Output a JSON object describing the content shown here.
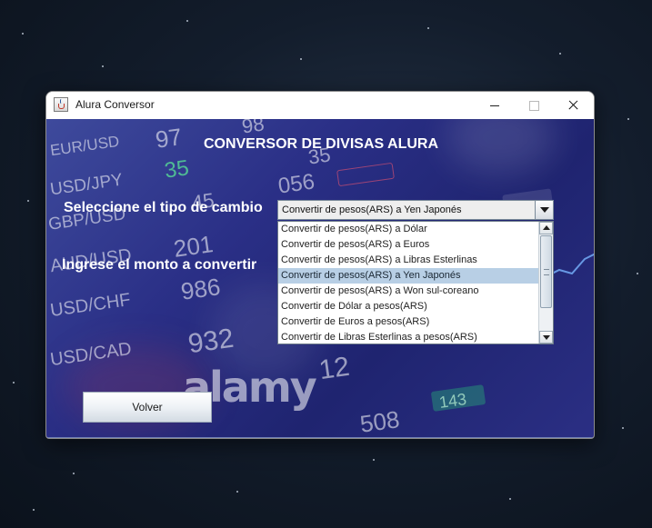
{
  "window": {
    "title": "Alura Conversor",
    "controls": {
      "minimize": "minimize",
      "maximize": "maximize",
      "close": "close"
    }
  },
  "main": {
    "heading": "CONVERSOR DE DIVISAS ALURA",
    "exchange_type_label": "Seleccione el tipo de cambio",
    "amount_label": "Ingrese el monto a convertir",
    "back_button": "Volver"
  },
  "combo": {
    "selected": "Convertir de pesos(ARS) a Yen Japonés",
    "options": [
      "Convertir de pesos(ARS) a Dólar",
      "Convertir de pesos(ARS) a Euros",
      "Convertir de pesos(ARS) a Libras Esterlinas",
      "Convertir de pesos(ARS) a Yen Japonés",
      "Convertir de pesos(ARS) a Won sul-coreano",
      "Convertir de Dólar a pesos(ARS)",
      "Convertir de Euros a pesos(ARS)",
      "Convertir de Libras Esterlinas a pesos(ARS)"
    ],
    "highlighted_index": 3
  },
  "background": {
    "watermark": "alamy",
    "tickers": [
      "EUR/USD",
      "USD/JPY",
      "GBP/USD",
      "AUD/USD",
      "USD/CHF",
      "USD/CAD"
    ],
    "quotes": [
      "97",
      "98",
      "35",
      "45",
      "201",
      "986",
      "932",
      "12",
      "508",
      "056",
      "143",
      "35"
    ]
  },
  "colors": {
    "accent_bg": "#2a2f86",
    "selection": "#b8cfe5",
    "text_on_bg": "#ffffff"
  },
  "icons": {
    "app": "java-cup-icon",
    "combo_arrow": "chevron-down-icon"
  }
}
